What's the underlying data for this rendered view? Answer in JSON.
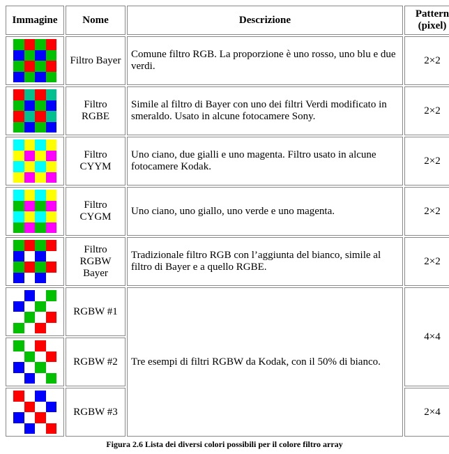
{
  "headers": {
    "image": "Immagine",
    "name": "Nome",
    "description": "Descrizione",
    "pattern_line1": "Pattern",
    "pattern_line2": "(pixel)"
  },
  "colors": {
    "R": "#ff0000",
    "G": "#00c000",
    "B": "#0000ff",
    "E": "#00c090",
    "C": "#00ffff",
    "Y": "#ffff00",
    "M": "#ff00ff",
    "W": "#ffffff"
  },
  "rows": [
    {
      "id": "bayer",
      "name": "Filtro Bayer",
      "description": "Comune filtro RGB. La proporzione è uno rosso, uno blu e due verdi.",
      "pattern": "2×2",
      "grid": [
        "G",
        "R",
        "G",
        "R",
        "B",
        "G",
        "B",
        "G",
        "G",
        "R",
        "G",
        "R",
        "B",
        "G",
        "B",
        "G"
      ]
    },
    {
      "id": "rgbe",
      "name": "Filtro RGBE",
      "description": "Simile al filtro di Bayer con uno dei filtri Verdi modificato in smeraldo. Usato in alcune fotocamere Sony.",
      "pattern": "2×2",
      "grid": [
        "R",
        "E",
        "R",
        "E",
        "G",
        "B",
        "G",
        "B",
        "R",
        "E",
        "R",
        "E",
        "G",
        "B",
        "G",
        "B"
      ]
    },
    {
      "id": "cyym",
      "name": "Filtro CYYM",
      "description": "Uno ciano, due gialli e uno magenta. Filtro usato in alcune fotocamere Kodak.",
      "pattern": "2×2",
      "grid": [
        "C",
        "Y",
        "C",
        "Y",
        "Y",
        "M",
        "Y",
        "M",
        "C",
        "Y",
        "C",
        "Y",
        "Y",
        "M",
        "Y",
        "M"
      ]
    },
    {
      "id": "cygm",
      "name": "Filtro CYGM",
      "description": "Uno ciano, uno giallo, uno verde e uno magenta.",
      "pattern": "2×2",
      "grid": [
        "C",
        "Y",
        "C",
        "Y",
        "G",
        "M",
        "G",
        "M",
        "C",
        "Y",
        "C",
        "Y",
        "G",
        "M",
        "G",
        "M"
      ]
    },
    {
      "id": "rgbw-bayer",
      "name": "Filtro RGBW Bayer",
      "description": "Tradizionale filtro RGB con l’aggiunta del bianco, simile al filtro di Bayer e a quello RGBE.",
      "pattern": "2×2",
      "grid": [
        "G",
        "R",
        "G",
        "R",
        "B",
        "W",
        "B",
        "W",
        "G",
        "R",
        "G",
        "R",
        "B",
        "W",
        "B",
        "W"
      ]
    },
    {
      "id": "rgbw1",
      "name": "RGBW #1",
      "description": null,
      "pattern": null,
      "grid": [
        "W",
        "B",
        "W",
        "G",
        "B",
        "W",
        "G",
        "W",
        "W",
        "G",
        "W",
        "R",
        "G",
        "W",
        "R",
        "W"
      ]
    },
    {
      "id": "rgbw2",
      "name": "RGBW #2",
      "description": null,
      "pattern": null,
      "grid": [
        "G",
        "W",
        "R",
        "W",
        "W",
        "G",
        "W",
        "R",
        "B",
        "W",
        "G",
        "W",
        "W",
        "B",
        "W",
        "G"
      ]
    },
    {
      "id": "rgbw3",
      "name": "RGBW #3",
      "description": null,
      "pattern": "2×4",
      "grid": [
        "R",
        "W",
        "B",
        "W",
        "W",
        "R",
        "W",
        "B",
        "B",
        "W",
        "R",
        "W",
        "W",
        "B",
        "W",
        "R"
      ]
    }
  ],
  "group_rgbw": {
    "description": "Tre esempi di filtri RGBW da Kodak, con il 50% di bianco.",
    "pattern": "4×4"
  },
  "caption": "Figura 2.6 Lista dei diversi colori possibili per il colore filtro array"
}
